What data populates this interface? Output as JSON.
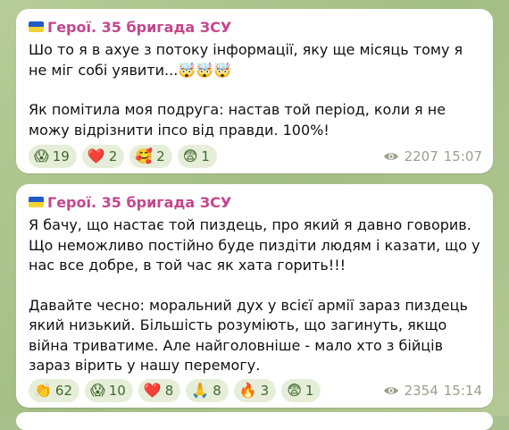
{
  "messages": [
    {
      "author": "Герої. 35 бригада ЗСУ",
      "paragraphs": [
        "Шо то я в ахуе з потоку інформації, яку ще місяць тому я не міг собі уявити...🤯🤯🤯",
        "Як помітила моя подруга: настав той період, коли я не можу відрізнити іпсо від правди. 100%!"
      ],
      "reactions": [
        {
          "emoji": "😱",
          "count": "19"
        },
        {
          "emoji": "❤️",
          "count": "2"
        },
        {
          "emoji": "🥰",
          "count": "2"
        },
        {
          "emoji": "😨",
          "count": "1"
        }
      ],
      "views": "2207",
      "time": "15:07"
    },
    {
      "author": "Герої. 35 бригада ЗСУ",
      "paragraphs": [
        "Я бачу, що настає той пиздець, про який я давно говорив. Що неможливо постійно буде пиздіти людям і казати, що у нас все добре, в той час як хата горить!!!",
        "Давайте чесно: моральний дух у всієї армії зараз пиздець який низький. Більшість розуміють, що загинуть, якщо війна триватиме. Але найголовніше - мало хто з бійців зараз вірить у нашу перемогу."
      ],
      "reactions": [
        {
          "emoji": "👏",
          "count": "62"
        },
        {
          "emoji": "😱",
          "count": "10"
        },
        {
          "emoji": "❤️",
          "count": "8"
        },
        {
          "emoji": "🙏",
          "count": "8"
        },
        {
          "emoji": "🔥",
          "count": "3"
        },
        {
          "emoji": "😨",
          "count": "1"
        }
      ],
      "views": "2354",
      "time": "15:14"
    }
  ],
  "icons": {
    "views": "eye-icon",
    "channel_flag": "ukraine-flag-icon"
  },
  "colors": {
    "author": "#c4468d",
    "reaction_bg": "#e6eed9",
    "reaction_text": "#3f6a2c",
    "meta": "#9aa18c"
  }
}
